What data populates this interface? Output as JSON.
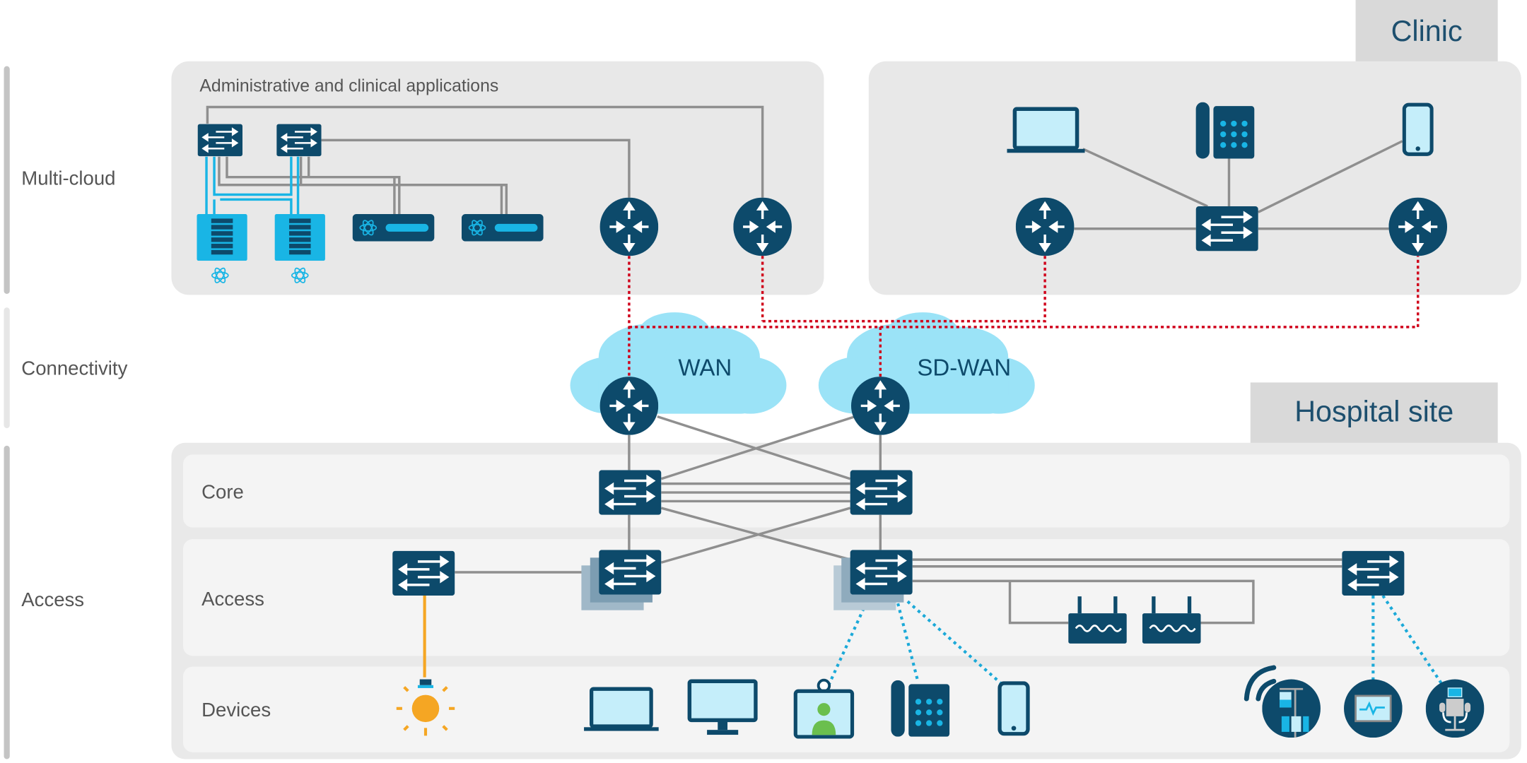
{
  "tiers": {
    "multicloud": "Multi-cloud",
    "connectivity": "Connectivity",
    "access": "Access"
  },
  "datacenter": {
    "title": "Administrative and clinical applications"
  },
  "clinic": {
    "tab": "Clinic"
  },
  "hospital": {
    "tab": "Hospital site",
    "rows": {
      "core": "Core",
      "access": "Access",
      "devices": "Devices"
    }
  },
  "clouds": {
    "wan": "WAN",
    "sdwan": "SD-WAN"
  },
  "colors": {
    "device": "#0d4a6b",
    "accent": "#19b5e5",
    "cloud": "#9be3f7",
    "wan_link": "#d0021b",
    "poe_link": "#f5a623",
    "wireless_link": "#1ba9d8",
    "panel": "#e8e8e8"
  }
}
